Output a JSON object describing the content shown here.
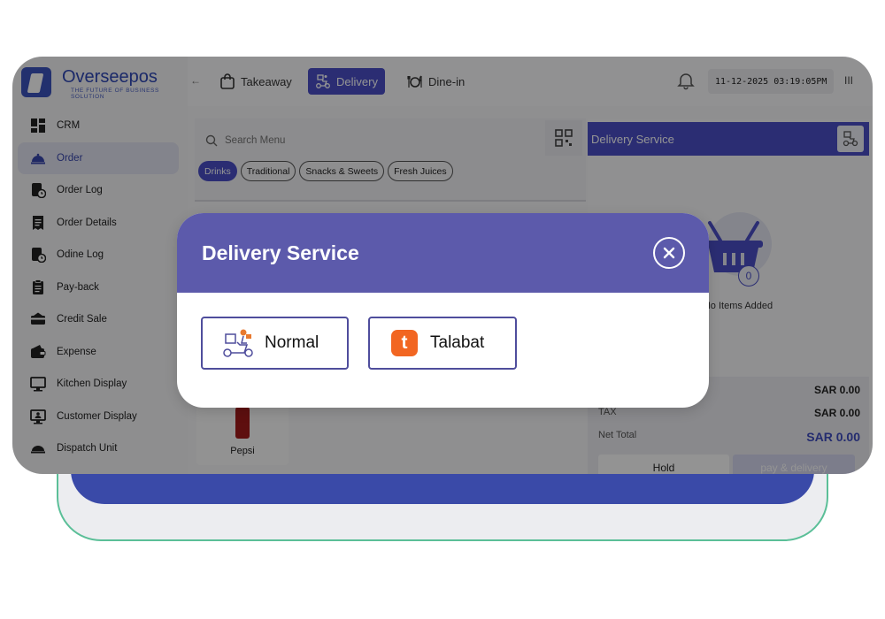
{
  "brand": {
    "name": "Overseepos",
    "tagline": "THE FUTURE OF BUSINESS SOLUTION"
  },
  "sidebar": {
    "items": [
      {
        "label": "CRM",
        "icon": "dashboard-icon"
      },
      {
        "label": "Order",
        "icon": "food-cloche-icon",
        "active": true
      },
      {
        "label": "Order Log",
        "icon": "order-log-icon"
      },
      {
        "label": "Order Details",
        "icon": "receipt-icon"
      },
      {
        "label": "Odine Log",
        "icon": "dine-log-icon"
      },
      {
        "label": "Pay-back",
        "icon": "clipboard-icon"
      },
      {
        "label": "Credit Sale",
        "icon": "credit-card-icon"
      },
      {
        "label": "Expense",
        "icon": "wallet-icon"
      },
      {
        "label": "Kitchen Display",
        "icon": "monitor-icon"
      },
      {
        "label": "Customer Display",
        "icon": "display-user-icon"
      },
      {
        "label": "Dispatch Unit",
        "icon": "dispatch-icon"
      }
    ]
  },
  "topbar": {
    "collapse": "←",
    "tabs": [
      {
        "label": "Takeaway",
        "icon": "bag-icon"
      },
      {
        "label": "Delivery",
        "icon": "delivery-icon",
        "active": true
      },
      {
        "label": "Dine-in",
        "icon": "dine-icon"
      }
    ],
    "datetime": "11-12-2025 03:19:05PM",
    "menu": "III"
  },
  "menu": {
    "search_placeholder": "Search Menu",
    "categories": [
      "Drinks",
      "Traditional",
      "Snacks & Sweets",
      "Fresh Juices"
    ],
    "active_category": "Drinks",
    "products": [
      {
        "name": "Pepsi"
      }
    ]
  },
  "order": {
    "header": "Delivery Service",
    "item_count": "0",
    "empty_message": "No Items Added",
    "subtotal_value": "SAR 0.00",
    "tax_label": "TAX",
    "tax_value": "SAR 0.00",
    "net_label": "Net Total",
    "net_value": "SAR 0.00",
    "hold_label": "Hold",
    "pay_label": "pay & delivery"
  },
  "modal": {
    "title": "Delivery Service",
    "options": [
      {
        "label": "Normal",
        "icon": "delivery-scooter-icon"
      },
      {
        "label": "Talabat",
        "icon": "talabat-logo-icon",
        "logo_letter": "t"
      }
    ]
  },
  "colors": {
    "accent": "#4a4fc6",
    "modal_header": "#5c5aab",
    "brand_blue": "#2f48b6",
    "talabat_orange": "#f26622",
    "deco_green": "#5bbf98"
  }
}
